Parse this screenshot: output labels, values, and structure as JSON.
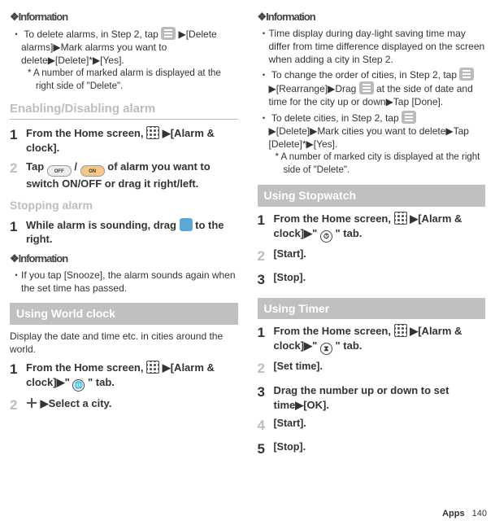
{
  "left": {
    "info1": {
      "heading": "❖Information",
      "bullet1_pre": "To delete alarms, in Step 2, tap ",
      "bullet1_post": " ▶[Delete alarms]▶Mark alarms you want to delete▶[Delete]*▶[Yes].",
      "footnote": "A number of marked alarm is displayed at the right side of \"Delete\"."
    },
    "enable": {
      "heading": "Enabling/Disabling alarm",
      "step1_pre": "From the Home screen, ",
      "step1_post": "▶[Alarm & clock].",
      "step2_pre": "Tap ",
      "step2_mid": " / ",
      "step2_post": " of alarm you want to switch ON/OFF or drag it right/left."
    },
    "stopping": {
      "heading": "Stopping alarm",
      "step1_pre": "While alarm is sounding, drag ",
      "step1_post": " to the right."
    },
    "info2": {
      "heading": "❖Information",
      "bullet1": "If you tap [Snooze], the alarm sounds again when the set time has passed."
    },
    "world": {
      "bar": "Using World clock",
      "intro": "Display the date and time etc. in cities around the world.",
      "step1_pre": "From the Home screen, ",
      "step1_post": "▶[Alarm & clock]▶\" ",
      "step1_end": " \" tab.",
      "step2_post": "▶Select a city."
    }
  },
  "right": {
    "info": {
      "heading": "❖Information",
      "bullet1": "Time display during day-light saving time may differ from time difference displayed on the screen when adding a city in Step 2.",
      "bullet2_pre": "To change the order of cities, in Step 2, tap ",
      "bullet2_mid": " ▶[Rearrange]▶Drag ",
      "bullet2_post": " at the side of date and time for the city up or down▶Tap [Done].",
      "bullet3_pre": "To delete cities, in Step 2, tap ",
      "bullet3_post": " ▶[Delete]▶Mark cities you want to delete▶Tap [Delete]*▶[Yes].",
      "footnote": "A number of marked city is displayed at the right side of \"Delete\"."
    },
    "stopwatch": {
      "bar": "Using Stopwatch",
      "step1_pre": "From the Home screen, ",
      "step1_post": "▶[Alarm & clock]▶\" ",
      "step1_end": " \" tab.",
      "step2": "[Start].",
      "step3": "[Stop]."
    },
    "timer": {
      "bar": "Using Timer",
      "step1_pre": "From the Home screen, ",
      "step1_post": "▶[Alarm & clock]▶\" ",
      "step1_end": " \" tab.",
      "step2": "[Set time].",
      "step3": "Drag the number up or down to set time▶[OK].",
      "step4": "[Start].",
      "step5": "[Stop]."
    }
  },
  "footer": {
    "label": "Apps",
    "page": "140"
  }
}
